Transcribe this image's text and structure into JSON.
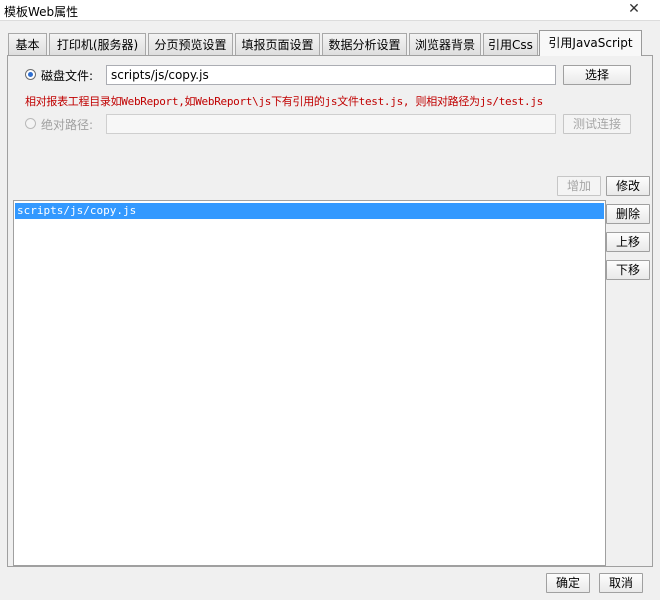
{
  "window": {
    "title": "模板Web属性",
    "close_glyph": "✕"
  },
  "tabs": [
    {
      "label": "基本"
    },
    {
      "label": "打印机(服务器)"
    },
    {
      "label": "分页预览设置"
    },
    {
      "label": "填报页面设置"
    },
    {
      "label": "数据分析设置"
    },
    {
      "label": "浏览器背景"
    },
    {
      "label": "引用Css"
    },
    {
      "label": "引用JavaScript",
      "active": true
    }
  ],
  "disk_file": {
    "label": "磁盘文件:",
    "value": "scripts/js/copy.js",
    "browse_button": "选择",
    "selected": true
  },
  "hint": "相对报表工程目录如WebReport,如WebReport\\js下有引用的js文件test.js, 则相对路径为js/test.js",
  "absolute_path": {
    "label": "绝对路径:",
    "value": "",
    "test_button": "测试连接",
    "selected": false
  },
  "actions": {
    "add": "增加",
    "modify": "修改",
    "delete": "删除",
    "move_up": "上移",
    "move_down": "下移"
  },
  "script_list": [
    "scripts/js/copy.js"
  ],
  "footer": {
    "ok": "确定",
    "cancel": "取消"
  },
  "colors": {
    "hint_text": "#c00000",
    "selection": "#3399ff",
    "radio_dot": "#2f6fd0"
  }
}
